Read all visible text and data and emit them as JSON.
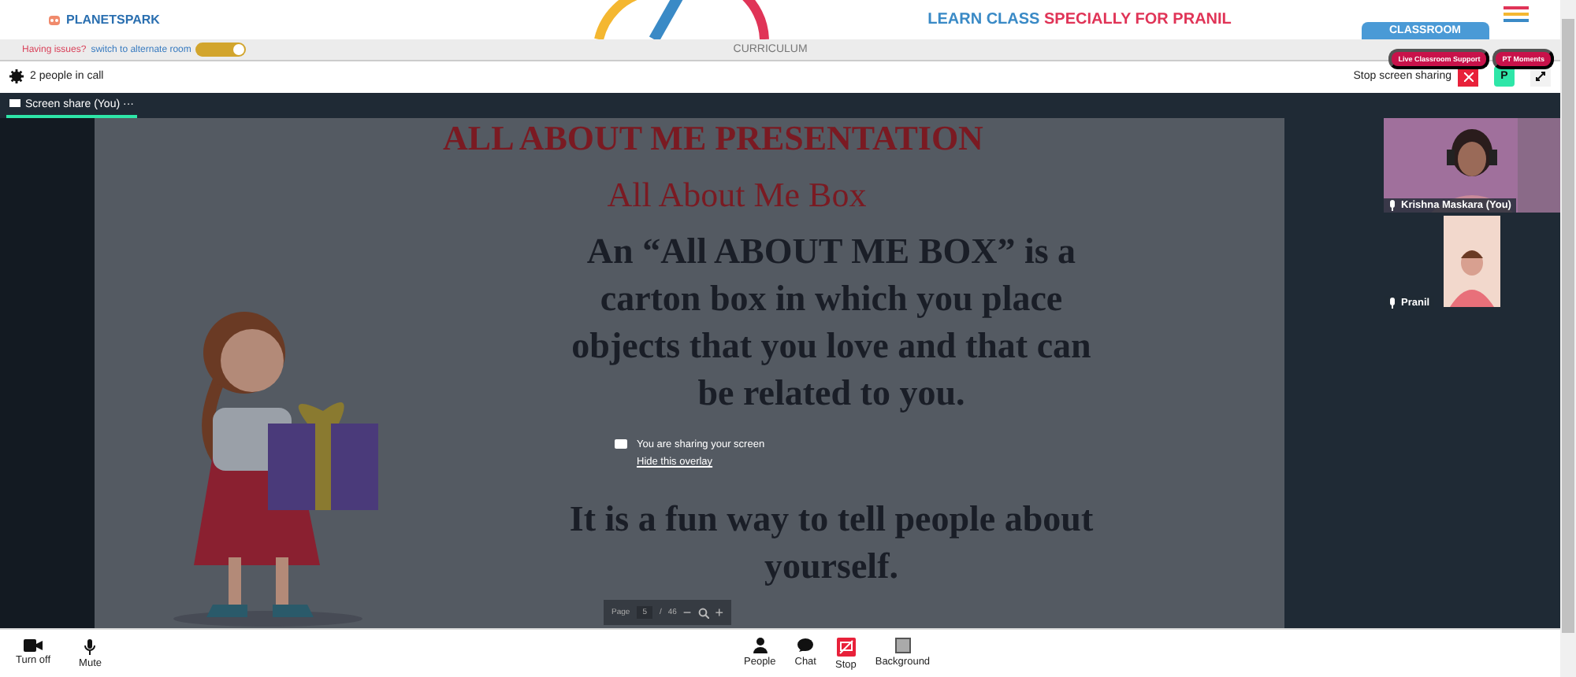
{
  "header": {
    "logo": "PLANETSPARK",
    "title_part1": "LEARN CLASS",
    "title_part2": "SPECIALLY FOR PRANIL",
    "classroom_tab": "CLASSROOM"
  },
  "subbar": {
    "issue_text": "Having issues?",
    "switch_link": "switch to alternate room",
    "toggle_on": true,
    "center_label": "CURRICULUM",
    "pills": [
      "Live Classroom Support",
      "PT Moments"
    ]
  },
  "call_bar": {
    "people_count": "2 people in call",
    "stop_label": "Stop screen sharing",
    "avatar_letter": "P"
  },
  "stage_tab": {
    "label": "Screen share (You)",
    "more": "···",
    "selected": true
  },
  "slide": {
    "heading": "ALL ABOUT ME PRESENTATION",
    "subheading": "All About Me Box",
    "paragraphs": [
      "An “All ABOUT ME BOX” is a carton box in which you place objects that you love and that can be related to you.",
      "It is a fun way to tell people about yourself."
    ],
    "overlay_title": "You are sharing your screen",
    "overlay_link": "Hide this overlay",
    "page_label": "Page",
    "page_number": "5",
    "page_sep": "/",
    "page_total": "46",
    "zoom_out": "−",
    "zoom_in": "+"
  },
  "participants": [
    {
      "name": "Krishna Maskara (You)",
      "kind": "wide"
    },
    {
      "name": "Pranil",
      "kind": "narrow"
    }
  ],
  "toolbar_left": [
    {
      "label": "Turn off"
    },
    {
      "label": "Mute"
    }
  ],
  "toolbar_center": [
    {
      "label": "People"
    },
    {
      "label": "Chat"
    },
    {
      "label": "Stop"
    },
    {
      "label": "Background"
    }
  ]
}
